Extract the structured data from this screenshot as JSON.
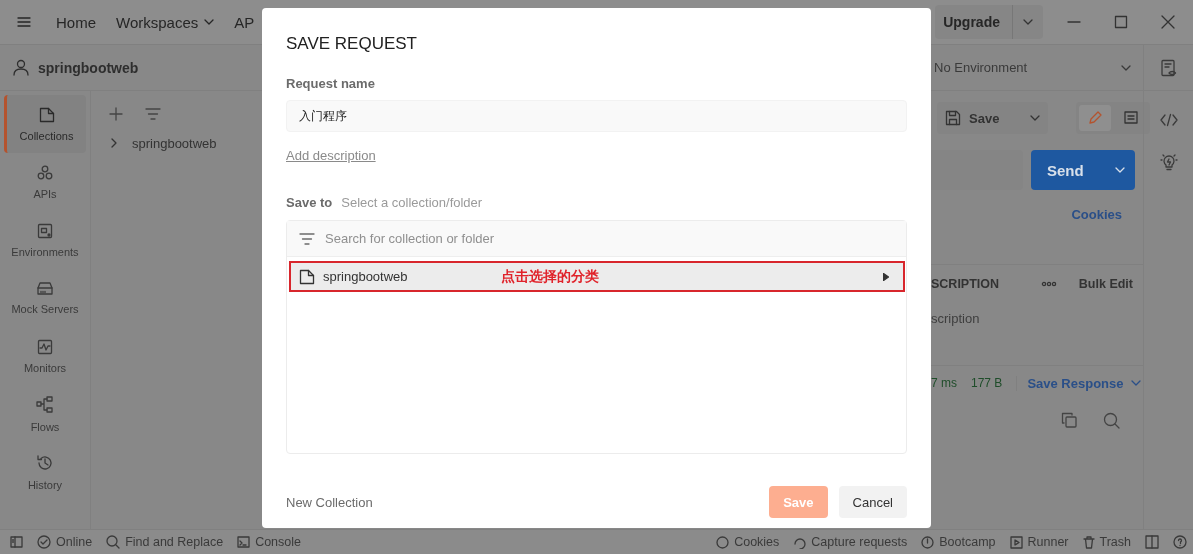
{
  "topbar": {
    "menu": [
      "Home",
      "Workspaces",
      "AP"
    ],
    "upgrade": "Upgrade"
  },
  "workspace": {
    "name": "springbootweb"
  },
  "sidebar": {
    "items": [
      {
        "label": "Collections",
        "kind": "collections",
        "selected": true
      },
      {
        "label": "APIs",
        "kind": "apis",
        "selected": false
      },
      {
        "label": "Environments",
        "kind": "environments",
        "selected": false
      },
      {
        "label": "Mock Servers",
        "kind": "mock",
        "selected": false
      },
      {
        "label": "Monitors",
        "kind": "monitors",
        "selected": false
      },
      {
        "label": "Flows",
        "kind": "flows",
        "selected": false
      },
      {
        "label": "History",
        "kind": "history",
        "selected": false
      }
    ]
  },
  "collections": {
    "tree": [
      {
        "label": "springbootweb",
        "expanded": false
      }
    ]
  },
  "request_pane": {
    "view_modes": [
      {
        "kind": "edit",
        "selected": true
      },
      {
        "kind": "comments",
        "selected": false
      }
    ],
    "environment": "No Environment",
    "save": "Save",
    "send": "Send",
    "cookies": "Cookies",
    "column_header": "SCRIPTION",
    "bulk_edit": "Bulk Edit",
    "column_placeholder": "scription",
    "time": "7 ms",
    "size": "177 B",
    "save_response": "Save Response"
  },
  "dialog": {
    "title": "SAVE REQUEST",
    "request_name_label": "Request name",
    "request_name": "入门程序",
    "add_description": "Add description",
    "save_to_label": "Save to",
    "save_to_hint": "Select a collection/folder",
    "search_placeholder": "Search for collection or folder",
    "collections": [
      {
        "name": "springbootweb",
        "selected": true
      }
    ],
    "annotation": "点击选择的分类",
    "new_collection": "New Collection",
    "save": "Save",
    "save_disabled": true,
    "cancel": "Cancel"
  },
  "status_bar": {
    "left": [
      "Online",
      "Find and Replace",
      "Console"
    ],
    "right": [
      "Cookies",
      "Capture requests",
      "Bootcamp",
      "Runner",
      "Trash"
    ]
  }
}
